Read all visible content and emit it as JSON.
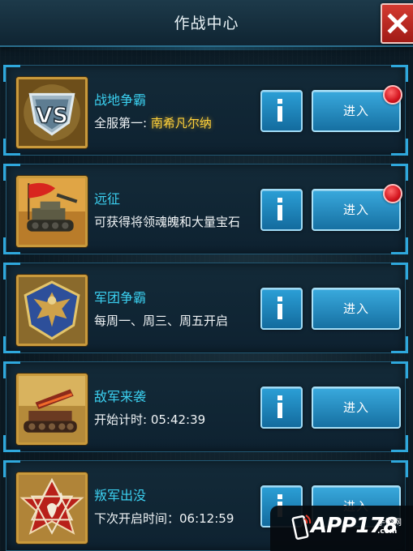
{
  "header": {
    "title": "作战中心"
  },
  "cards": [
    {
      "name": "战地争霸",
      "desc_prefix": "全服第一: ",
      "desc_highlight": "南希凡尔纳",
      "info_label": "i",
      "enter_label": "进入",
      "has_notification": true,
      "icon": "vs-badge-icon"
    },
    {
      "name": "远征",
      "desc_prefix": "可获得将领魂魄和大量宝石",
      "desc_highlight": "",
      "info_label": "i",
      "enter_label": "进入",
      "has_notification": true,
      "icon": "tank-flag-icon"
    },
    {
      "name": "军团争霸",
      "desc_prefix": "每周一、周三、周五开启",
      "desc_highlight": "",
      "info_label": "i",
      "enter_label": "进入",
      "has_notification": false,
      "icon": "eagle-shield-icon"
    },
    {
      "name": "敌军来袭",
      "desc_prefix": "开始计时: 05:42:39",
      "desc_highlight": "",
      "info_label": "i",
      "enter_label": "进入",
      "has_notification": false,
      "icon": "rocket-launcher-icon"
    },
    {
      "name": "叛军出没",
      "desc_prefix": "下次开启时间：06:12:59",
      "desc_highlight": "",
      "info_label": "i",
      "enter_label": "进入",
      "has_notification": false,
      "icon": "scorpion-star-icon"
    }
  ],
  "watermark": {
    "brand": "APP178",
    "sub": "手游网",
    "site": ".com"
  },
  "colors": {
    "accent_cyan": "#3bd0f0",
    "highlight_gold": "#ffd23a",
    "button_blue": "#1f8cc4",
    "notification_red": "#d4141e",
    "close_red": "#c22a22"
  }
}
